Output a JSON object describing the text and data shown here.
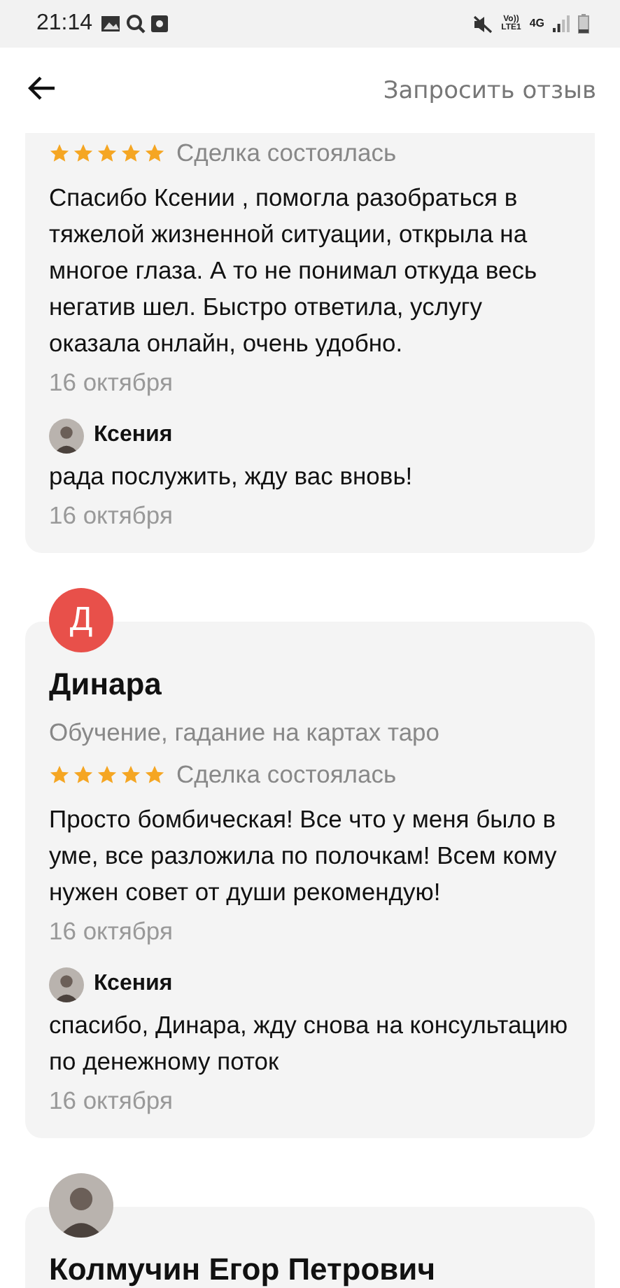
{
  "status_bar": {
    "time": "21:14",
    "volte": "Vo))",
    "lte": "LTE1",
    "network": "4G"
  },
  "header": {
    "action": "Запросить отзыв"
  },
  "reviews": [
    {
      "stars": 5,
      "deal": "Сделка состоялась",
      "text": "Спасибо Ксении , помогла разобраться в тяжелой жизненной ситуации, открыла на многое глаза. А то не понимал откуда весь негатив шел. Быстро ответила, услугу оказала онлайн, очень удобно.",
      "date": "16 октября",
      "reply": {
        "author": "Ксения",
        "text": "рада послужить, жду вас вновь!",
        "date": "16 октября"
      }
    },
    {
      "avatar": {
        "kind": "letter",
        "letter": "Д",
        "color": "#e8504a"
      },
      "name": "Динара",
      "subtitle": "Обучение, гадание на картах таро",
      "stars": 5,
      "deal": "Сделка состоялась",
      "text": "Просто бомбическая! Все что у меня было в уме, все разложила по полочкам! Всем кому нужен совет от души рекомендую!",
      "date": "16 октября",
      "reply": {
        "author": "Ксения",
        "text": "спасибо, Динара, жду снова на консультацию по денежному поток",
        "date": "16 октября"
      }
    },
    {
      "name": "Колмучин Егор Петрович"
    }
  ]
}
